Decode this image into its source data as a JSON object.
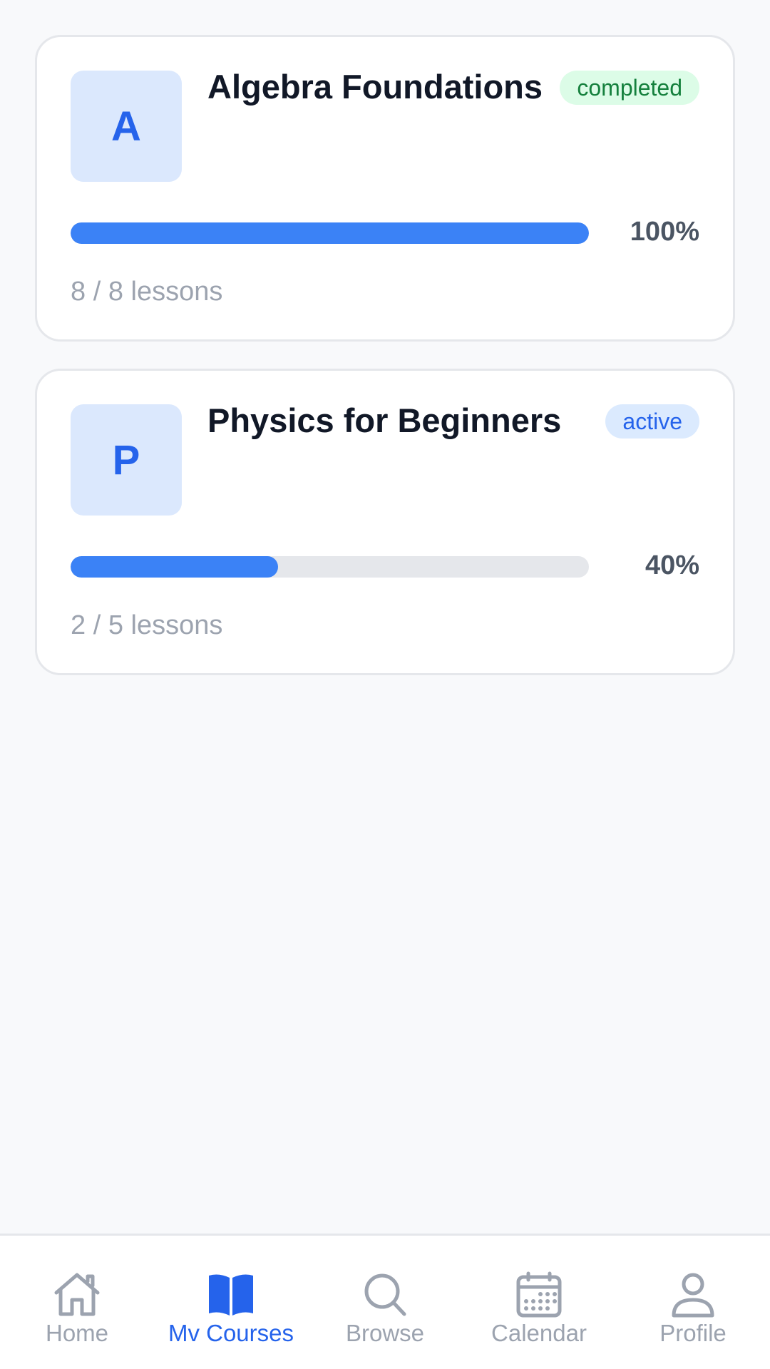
{
  "courses": [
    {
      "initial": "A",
      "title": "Algebra Foundations",
      "status": "completed",
      "progress_percent": 100,
      "progress_label": "100%",
      "lessons_done": "8",
      "lessons_total": "8",
      "lessons_word": "lessons"
    },
    {
      "initial": "P",
      "title": "Physics for Beginners",
      "status": "active",
      "progress_percent": 40,
      "progress_label": "40%",
      "lessons_done": "2",
      "lessons_total": "5",
      "lessons_word": "lessons"
    }
  ],
  "nav": {
    "items": [
      {
        "label": "Home",
        "icon": "home-icon",
        "active": false
      },
      {
        "label": "Mv Courses",
        "icon": "book-icon",
        "active": true
      },
      {
        "label": "Browse",
        "icon": "search-icon",
        "active": false
      },
      {
        "label": "Calendar",
        "icon": "calendar-icon",
        "active": false
      },
      {
        "label": "Profile",
        "icon": "user-icon",
        "active": false
      }
    ]
  },
  "colors": {
    "accent": "#2563eb",
    "progress_fill": "#3b82f6",
    "completed_badge_bg": "#dcfce7",
    "completed_badge_text": "#15803d",
    "active_badge_bg": "#dbeafe"
  }
}
